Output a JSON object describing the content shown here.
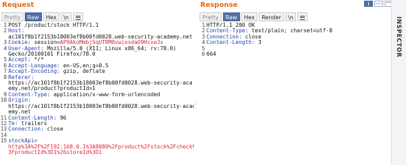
{
  "request": {
    "title": "Request",
    "buttons": {
      "pretty": "Pretty",
      "raw": "Raw",
      "hex": "Hex",
      "newline": "\\n"
    },
    "lines": [
      [
        {
          "t": "POST /product/stock HTTP/1.1",
          "c": "val"
        }
      ],
      [
        {
          "t": "Host: ",
          "c": "key"
        }
      ],
      [
        {
          "t": "ac101f8b1f2153b18003ef8b00fd0028.web-security-academy.net",
          "c": "val"
        }
      ],
      [
        {
          "t": "Cookie: ",
          "c": "key"
        },
        {
          "t": "session=",
          "c": "val"
        },
        {
          "t": "AP9AkoMmbjSqUTRM0vwiosdaO9HcxeJx",
          "c": "sess"
        }
      ],
      [
        {
          "t": "User-Agent: ",
          "c": "key"
        },
        {
          "t": "Mozilla/5.0 (X11; Linux x86_64; rv:78.0)",
          "c": "val"
        }
      ],
      [
        {
          "t": "Gecko/20100101 Firefox/78.0",
          "c": "val"
        }
      ],
      [
        {
          "t": "Accept: ",
          "c": "key"
        },
        {
          "t": "*/*",
          "c": "val"
        }
      ],
      [
        {
          "t": "Accept-Language: ",
          "c": "key"
        },
        {
          "t": "en-US,en;q=0.5",
          "c": "val"
        }
      ],
      [
        {
          "t": "Accept-Encoding: ",
          "c": "key"
        },
        {
          "t": "gzip, deflate",
          "c": "val"
        }
      ],
      [
        {
          "t": "Referer: ",
          "c": "key"
        }
      ],
      [
        {
          "t": "https://ac101f8b1f2153b18003ef8b00fd0028.web-security-aca",
          "c": "val"
        }
      ],
      [
        {
          "t": "emy.net/product?productId=1",
          "c": "val"
        }
      ],
      [
        {
          "t": "Content-Type: ",
          "c": "key"
        },
        {
          "t": "application/x-www-form-urlencoded",
          "c": "val"
        }
      ],
      [
        {
          "t": "Origin: ",
          "c": "key"
        }
      ],
      [
        {
          "t": "https://ac101f8b1f2153b18003ef8b00fd0028.web-security-acad",
          "c": "val"
        }
      ],
      [
        {
          "t": "emy.net",
          "c": "val"
        }
      ],
      [
        {
          "t": "Content-Length: ",
          "c": "key"
        },
        {
          "t": "96",
          "c": "val"
        }
      ],
      [
        {
          "t": "Te: ",
          "c": "key"
        },
        {
          "t": "trailers",
          "c": "val"
        }
      ],
      [
        {
          "t": "Connection: ",
          "c": "key"
        },
        {
          "t": "close",
          "c": "val"
        }
      ],
      [
        {
          "t": "",
          "c": "val"
        }
      ],
      [
        {
          "t": "stockApi=",
          "c": "param"
        }
      ],
      [
        {
          "t": "http%3A%2F%2F192.168.0.1%3A8080%2Fproduct%2Fstock%2Fcheck%",
          "c": "urlenc"
        }
      ],
      [
        {
          "t": "3FproductId%3D1%26storeId%3D1",
          "c": "urlenc"
        }
      ]
    ],
    "line_numbers": [
      "1",
      "2",
      "",
      "3",
      "4",
      "",
      "5",
      "6",
      "7",
      "8",
      "",
      "",
      "9",
      "10",
      "",
      "",
      "11",
      "12",
      "13",
      "14",
      "15",
      "",
      ""
    ]
  },
  "response": {
    "title": "Response",
    "buttons": {
      "pretty": "Pretty",
      "raw": "Raw",
      "hex": "Hex",
      "render": "Render",
      "newline": "\\n"
    },
    "lines": [
      [
        {
          "t": "HTTP/1.1 200 OK",
          "c": "val"
        }
      ],
      [
        {
          "t": "Content-Type: ",
          "c": "key"
        },
        {
          "t": "text/plain; charset=utf-8",
          "c": "val"
        }
      ],
      [
        {
          "t": "Connection: ",
          "c": "key"
        },
        {
          "t": "close",
          "c": "val"
        }
      ],
      [
        {
          "t": "Content-Length: ",
          "c": "key"
        },
        {
          "t": "3",
          "c": "val"
        }
      ],
      [
        {
          "t": "",
          "c": "val"
        }
      ],
      [
        {
          "t": "664",
          "c": "val"
        }
      ]
    ],
    "line_numbers": [
      "1",
      "2",
      "3",
      "4",
      "5",
      "6"
    ]
  },
  "inspector": {
    "label": "INSPECTOR"
  },
  "icons": {
    "menu": "hamburger-menu-icon",
    "layout": "layout-toggle-icon"
  },
  "colors": {
    "accent": "#e8660c",
    "active_button": "#4f6fa3",
    "header_key": "#1e3fa8",
    "highlight": "#d9263a"
  }
}
